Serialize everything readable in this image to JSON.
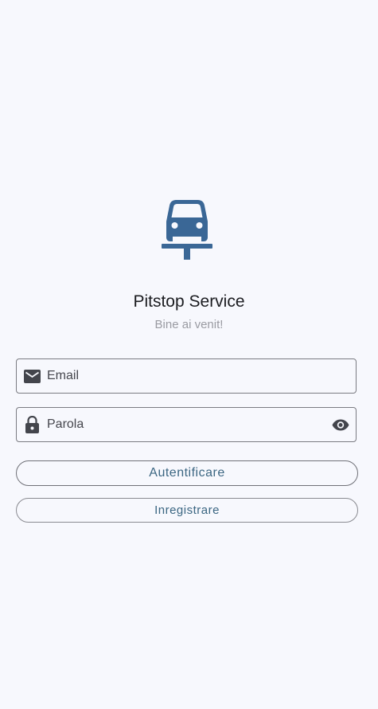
{
  "app": {
    "title": "Pitstop Service",
    "subtitle": "Bine ai venit!",
    "logo_icon": "car-lift-icon",
    "brand_color": "#3a6796"
  },
  "form": {
    "email": {
      "placeholder": "Email",
      "icon": "mail-icon"
    },
    "password": {
      "placeholder": "Parola",
      "icon": "lock-icon",
      "toggle_icon": "eye-icon"
    }
  },
  "buttons": {
    "login_label": "Autentificare",
    "register_label": "Inregistrare",
    "text_color": "#3b6682"
  }
}
